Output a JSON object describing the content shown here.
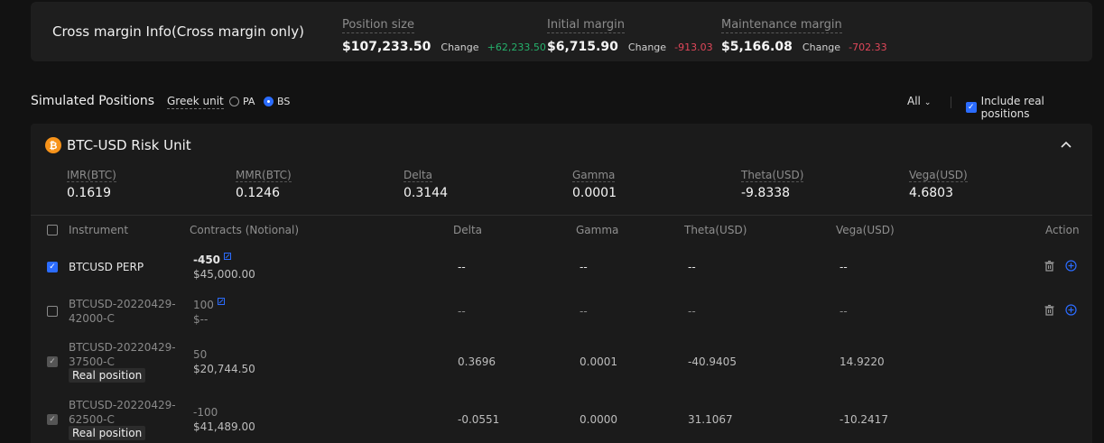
{
  "cross_margin": {
    "title": "Cross margin Info(Cross margin only)",
    "change_label": "Change",
    "position_size": {
      "label": "Position size",
      "value": "$107,233.50",
      "change": "+62,233.50"
    },
    "initial_margin": {
      "label": "Initial margin",
      "value": "$6,715.90",
      "change": "-913.03"
    },
    "maintenance_margin": {
      "label": "Maintenance margin",
      "value": "$5,166.08",
      "change": "-702.33"
    }
  },
  "simulated": {
    "title": "Simulated Positions",
    "greek_unit_label": "Greek unit",
    "greek_options": [
      "PA",
      "BS"
    ],
    "greek_selected": "BS",
    "filter": "All",
    "include_real_label": "Include real positions",
    "include_real_checked": true
  },
  "risk_unit": {
    "icon": "bitcoin-icon",
    "title": "BTC-USD Risk Unit",
    "stats": [
      {
        "label": "IMR(BTC)",
        "value": "0.1619"
      },
      {
        "label": "MMR(BTC)",
        "value": "0.1246"
      },
      {
        "label": "Delta",
        "value": "0.3144"
      },
      {
        "label": "Gamma",
        "value": "0.0001"
      },
      {
        "label": "Theta(USD)",
        "value": "-9.8338"
      },
      {
        "label": "Vega(USD)",
        "value": "4.6803"
      }
    ]
  },
  "table": {
    "headers": {
      "instrument": "Instrument",
      "contracts": "Contracts (Notional)",
      "delta": "Delta",
      "gamma": "Gamma",
      "theta": "Theta(USD)",
      "vega": "Vega(USD)",
      "action": "Action"
    },
    "real_badge": "Real position",
    "rows": [
      {
        "line1": "BTCUSD PERP",
        "line2": "",
        "contracts": "-450",
        "notional": "$45,000.00",
        "delta": "--",
        "gamma": "--",
        "theta": "--",
        "vega": "--"
      },
      {
        "line1": "BTCUSD-20220429-",
        "line2": "42000-C",
        "contracts": "100",
        "notional": "$--",
        "delta": "--",
        "gamma": "--",
        "theta": "--",
        "vega": "--"
      },
      {
        "line1": "BTCUSD-20220429-",
        "line2": "37500-C",
        "contracts": "50",
        "notional": "$20,744.50",
        "delta": "0.3696",
        "gamma": "0.0001",
        "theta": "-40.9405",
        "vega": "14.9220"
      },
      {
        "line1": "BTCUSD-20220429-",
        "line2": "62500-C",
        "contracts": "-100",
        "notional": "$41,489.00",
        "delta": "-0.0551",
        "gamma": "0.0000",
        "theta": "31.1067",
        "vega": "-10.2417"
      }
    ]
  },
  "colors": {
    "accent": "#2b6cff",
    "positive": "#25b06b",
    "negative": "#e0475a",
    "bitcoin": "#f7931a"
  }
}
